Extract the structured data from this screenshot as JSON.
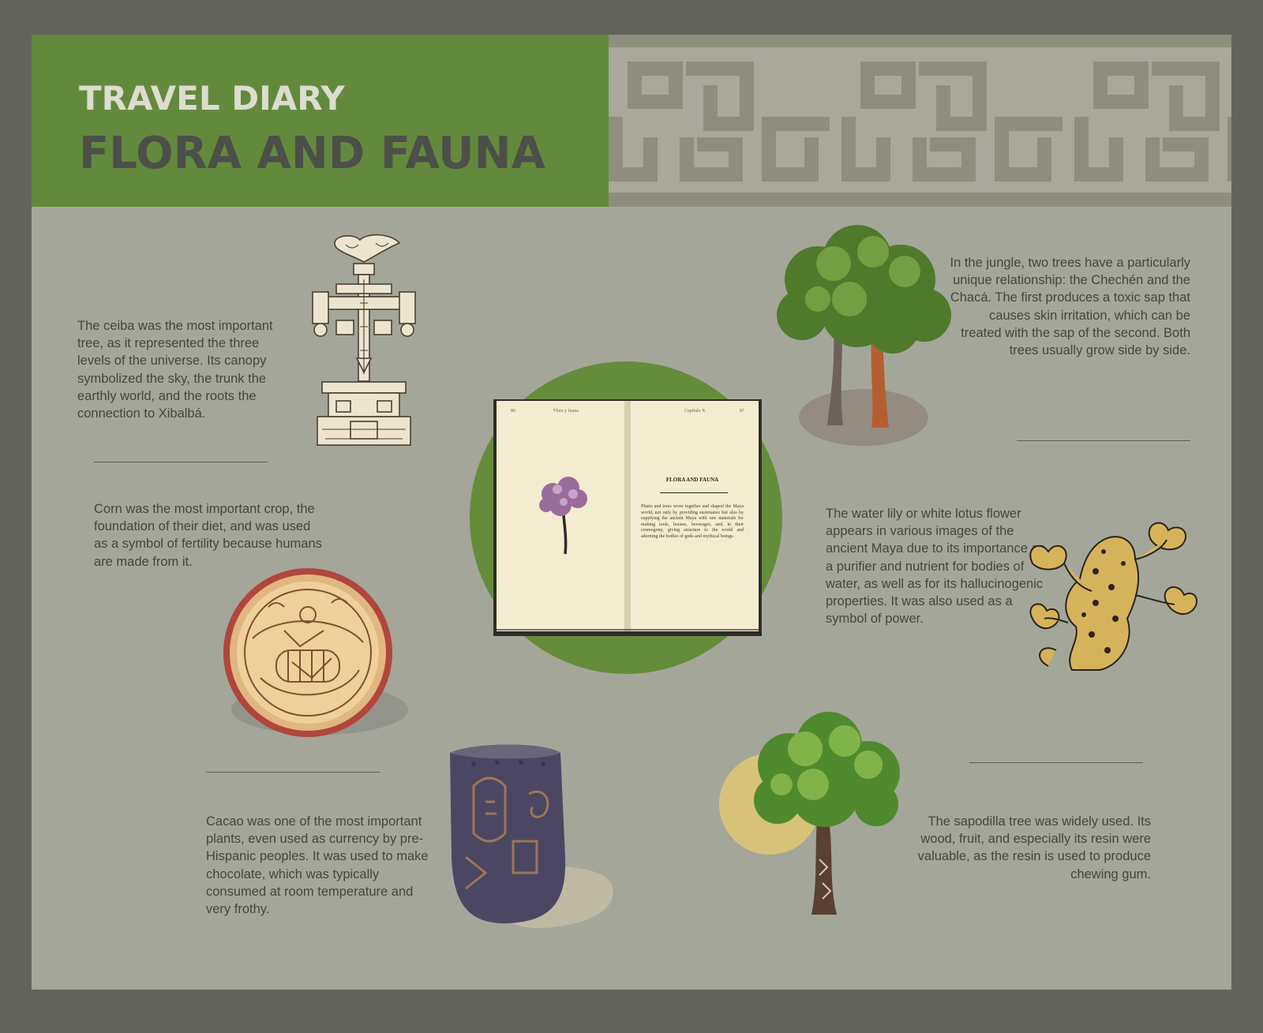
{
  "header": {
    "kicker": "TRAVEL DIARY",
    "title": "FLORA AND FAUNA"
  },
  "sections": {
    "ceiba": "The ceiba was the most important tree, as it represented the three levels of the universe. Its canopy symbolized the sky, the trunk the earthly world, and the roots the connection to Xibalbá.",
    "corn": "Corn was the most important crop, the foundation of their diet, and was used as a symbol of fertility because humans are made from it.",
    "cacao": "Cacao was one of the most important plants, even used as currency by pre-Hispanic peoples. It was used to make chocolate, which was typically consumed at room temperature and very frothy.",
    "jungle_trees": "In the jungle, two trees have a particularly unique relationship: the Chechén and the Chacá. The first produces a toxic sap that causes skin irritation, which can be treated with the sap of the second. Both trees usually grow side by side.",
    "water_lily": "The water lily or white lotus flower appears in various images of the ancient Maya due to its importance as a purifier and nutrient for bodies of water, as well as for its hallucinogenic properties. It was also used as a symbol of power.",
    "sapodilla": "The sapodilla tree was widely used. Its wood, fruit, and especially its resin were valuable, as the resin is used to produce chewing gum."
  },
  "book": {
    "left_page_number": "86",
    "left_running_head": "Flora y fauna",
    "right_running_head": "Capítulo X",
    "right_page_number": "87",
    "heading": "FLORA AND FAUNA",
    "body": "Plants and trees wove together and shaped the Maya world, not only by providing sustenance but also by supplying the ancient Maya with raw materials for making tools, houses, beverages, and, in their cosmogony, giving structure to the world and adorning the bodies of gods and mythical beings."
  },
  "colors": {
    "frame": "#62645c",
    "panel": "#a4a69a",
    "header_green": "#638a3c",
    "accent_green": "#658c3b",
    "accent_yellow": "#d8c27a",
    "text": "#45463f"
  },
  "icons": [
    "ceiba-cosmic-tree-icon",
    "maya-plate-icon",
    "cacao-vessel-icon",
    "twin-trees-icon",
    "jaguar-lotus-icon",
    "sapodilla-tree-icon",
    "open-book-icon",
    "fret-pattern-icon"
  ]
}
